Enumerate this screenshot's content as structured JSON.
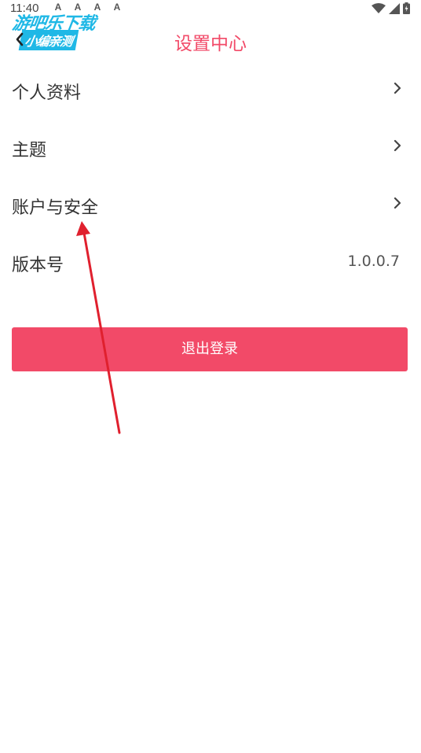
{
  "status_bar": {
    "time": "11:40",
    "notification_icons": [
      "A",
      "A",
      "A",
      "A"
    ]
  },
  "watermark": {
    "line1": "游吧乐下载",
    "line2": "小编亲测"
  },
  "header": {
    "title": "设置中心",
    "back_icon": "chevron-left-icon"
  },
  "settings": {
    "items": [
      {
        "label": "个人资料",
        "has_chevron": true
      },
      {
        "label": "主题",
        "has_chevron": true
      },
      {
        "label": "账户与安全",
        "has_chevron": true
      },
      {
        "label": "版本号",
        "value": "1.0.0.7"
      }
    ]
  },
  "logout": {
    "label": "退出登录"
  },
  "colors": {
    "accent": "#f24a68",
    "watermark": "#1fb8e6",
    "annotation": "#e0202e"
  }
}
